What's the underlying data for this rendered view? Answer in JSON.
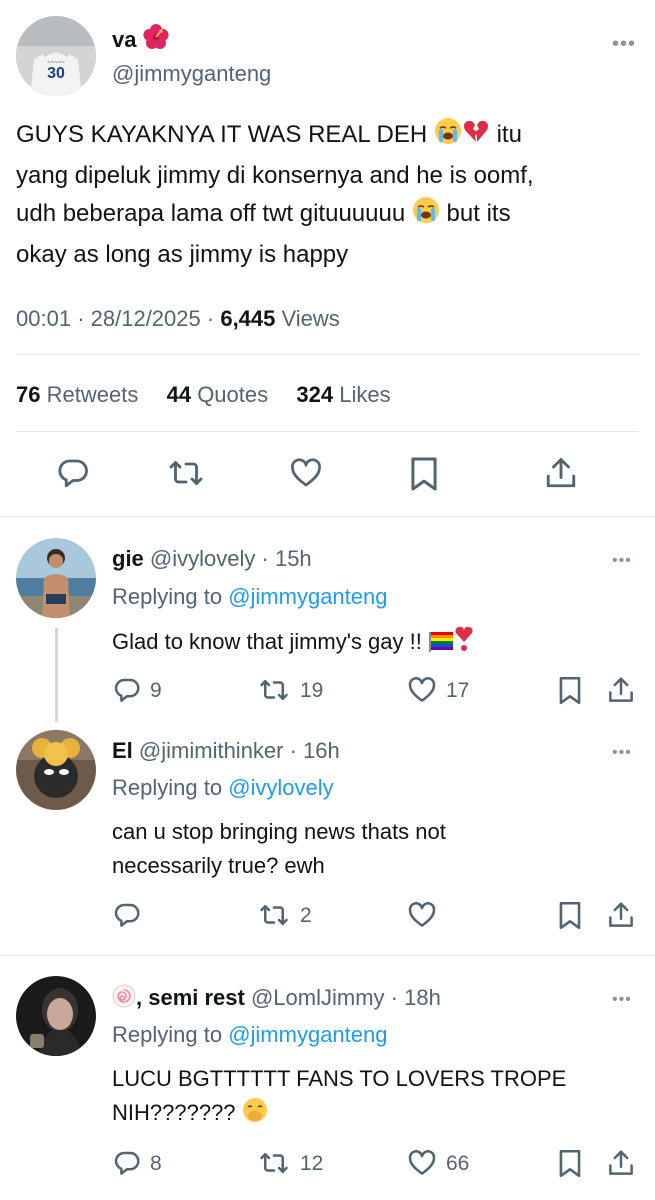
{
  "main_tweet": {
    "display_name": "va",
    "handle": "@jimmyganteng",
    "text_lines": [
      "GUYS KAYAKNYA IT WAS REAL DEH",
      "itu",
      "yang dipeluk jimmy di konsernya and he is oomf,",
      "udh beberapa lama off twt gituuuuuu",
      "but its",
      "okay as long as jimmy is happy"
    ],
    "time": "00:01",
    "date": "28/12/2025",
    "separator": "·",
    "views_count": "6,445",
    "views_label": "Views",
    "retweets_count": "76",
    "retweets_label": "Retweets",
    "quotes_count": "44",
    "quotes_label": "Quotes",
    "likes_count": "324",
    "likes_label": "Likes",
    "more": "•••",
    "jersey_number": "30"
  },
  "reply_prefix": "Replying to",
  "replies": [
    {
      "name": "gie",
      "handle": "@ivylovely",
      "time": "· 15h",
      "replying_to": "@jimmyganteng",
      "text_lines": [
        "Glad to know that jimmy's gay !!"
      ],
      "reply_count": "9",
      "retweet_count": "19",
      "like_count": "17"
    },
    {
      "name": "El",
      "handle": "@jimimithinker",
      "time": "· 16h",
      "replying_to": "@ivylovely",
      "text_lines": [
        "can u stop bringing news thats not",
        "necessarily true? ewh"
      ],
      "reply_count": "",
      "retweet_count": "2",
      "like_count": ""
    },
    {
      "name": ", semi rest",
      "handle": "@LomlJimmy",
      "time": "· 18h",
      "replying_to": "@jimmyganteng",
      "text_lines": [
        "LUCU BGTTTTTT FANS TO LOVERS TROPE",
        "NIH???????"
      ],
      "reply_count": "8",
      "retweet_count": "12",
      "like_count": "66"
    }
  ],
  "icons": [
    "reply-icon",
    "retweet-icon",
    "like-icon",
    "bookmark-icon",
    "share-icon",
    "more-icon"
  ],
  "colors": {
    "text": "#0f1419",
    "secondary": "#536471",
    "link": "#1d9bf0",
    "divider": "#e6e9eb"
  }
}
